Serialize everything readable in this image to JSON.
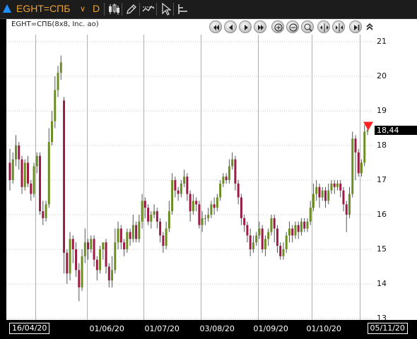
{
  "toolbar": {
    "symbol": "EGHT=СПБ",
    "interval": "D",
    "icons": [
      "up-arrow-icon",
      "chevron-down-icon",
      "candlestick-icon",
      "pencil-icon",
      "crosshair-icon",
      "cursor-icon",
      "indicator-icon"
    ]
  },
  "legend": {
    "title": "EGHT=СПБ(8x8, Inc. ao)"
  },
  "nav_icons": [
    "first-icon",
    "prev-icon",
    "play-icon",
    "last-icon",
    "zoom-in-icon",
    "zoom-out-icon",
    "zoom-fit-icon",
    "expand-icon",
    "compress-icon",
    "end-icon",
    "collapse-up-icon"
  ],
  "last_price_label": "18,44",
  "colors": {
    "up": "#6b8e23",
    "down": "#9b1b45",
    "marker": "#ff2020",
    "background": "#ffffff",
    "grid": "#c8c8c8"
  },
  "chart_data": {
    "type": "candlestick",
    "title": "EGHT=СПБ(8x8, Inc. ao)",
    "ylim": [
      13,
      21.5
    ],
    "y_ticks": [
      "13",
      "14",
      "15",
      "16",
      "17",
      "18",
      "19",
      "20",
      "21"
    ],
    "x_labels": [
      "16/04/20",
      "01/06/20",
      "01/07/20",
      "03/08/20",
      "01/09/20",
      "01/10/20",
      "05/11/20"
    ],
    "grid": "horizontal dotted, vertical solid at month boundaries",
    "last_value": 18.44,
    "candles": [
      [
        17.5,
        17.0,
        17.9,
        16.7
      ],
      [
        17.0,
        17.6,
        17.8,
        16.9
      ],
      [
        17.6,
        18.0,
        18.3,
        17.4
      ],
      [
        18.0,
        17.6,
        18.1,
        17.3
      ],
      [
        17.6,
        16.8,
        17.7,
        16.6
      ],
      [
        16.8,
        17.5,
        17.6,
        16.7
      ],
      [
        17.5,
        16.9,
        17.7,
        16.8
      ],
      [
        16.9,
        16.6,
        17.0,
        16.4
      ],
      [
        16.6,
        17.4,
        17.5,
        16.5
      ],
      [
        17.4,
        17.7,
        17.8,
        17.2
      ],
      [
        17.7,
        16.1,
        17.8,
        16.0
      ],
      [
        16.1,
        15.9,
        16.4,
        15.7
      ],
      [
        15.9,
        16.3,
        16.4,
        15.8
      ],
      [
        16.3,
        18.1,
        18.5,
        16.2
      ],
      [
        18.1,
        18.7,
        19.0,
        18.0
      ],
      [
        18.7,
        19.6,
        20.0,
        18.5
      ],
      [
        19.6,
        20.1,
        20.3,
        19.4
      ],
      [
        20.1,
        20.4,
        20.6,
        19.9
      ],
      [
        19.3,
        14.9,
        19.4,
        14.3
      ],
      [
        14.9,
        14.3,
        15.0,
        14.0
      ],
      [
        14.3,
        15.3,
        15.5,
        14.1
      ],
      [
        15.3,
        15.0,
        15.4,
        14.6
      ],
      [
        15.0,
        14.4,
        15.2,
        14.2
      ],
      [
        14.4,
        13.9,
        14.6,
        13.5
      ],
      [
        13.9,
        14.8,
        15.0,
        13.8
      ],
      [
        14.8,
        15.2,
        15.6,
        14.6
      ],
      [
        15.2,
        15.0,
        15.3,
        14.7
      ],
      [
        15.0,
        15.3,
        15.4,
        14.9
      ],
      [
        15.3,
        14.7,
        15.4,
        14.5
      ],
      [
        14.7,
        14.4,
        14.8,
        14.1
      ],
      [
        14.4,
        15.0,
        15.1,
        14.3
      ],
      [
        15.0,
        15.2,
        15.2,
        14.7
      ],
      [
        15.2,
        14.5,
        15.3,
        14.3
      ],
      [
        14.5,
        14.1,
        14.6,
        13.9
      ],
      [
        14.1,
        14.4,
        14.8,
        13.9
      ],
      [
        14.4,
        15.2,
        15.6,
        14.3
      ],
      [
        15.2,
        15.6,
        15.8,
        15.0
      ],
      [
        15.6,
        15.2,
        15.7,
        15.0
      ],
      [
        15.2,
        15.0,
        15.3,
        14.8
      ],
      [
        15.0,
        15.5,
        15.6,
        14.9
      ],
      [
        15.5,
        15.3,
        15.6,
        15.1
      ],
      [
        15.3,
        15.7,
        16.0,
        15.2
      ],
      [
        15.7,
        15.3,
        15.8,
        15.2
      ],
      [
        15.3,
        15.8,
        16.0,
        15.2
      ],
      [
        15.8,
        16.4,
        16.6,
        15.6
      ],
      [
        16.4,
        16.2,
        16.5,
        15.9
      ],
      [
        16.2,
        15.8,
        16.3,
        15.7
      ],
      [
        15.8,
        16.0,
        16.1,
        15.6
      ],
      [
        16.0,
        16.1,
        16.3,
        15.9
      ],
      [
        16.1,
        15.8,
        16.2,
        15.6
      ],
      [
        15.8,
        15.4,
        15.9,
        15.2
      ],
      [
        15.4,
        15.1,
        15.5,
        14.9
      ],
      [
        15.1,
        15.6,
        15.8,
        15.0
      ],
      [
        15.6,
        16.1,
        16.4,
        15.5
      ],
      [
        16.1,
        17.0,
        17.2,
        16.0
      ],
      [
        17.0,
        16.7,
        17.1,
        16.5
      ],
      [
        16.7,
        16.6,
        16.8,
        16.4
      ],
      [
        16.6,
        16.9,
        17.0,
        16.5
      ],
      [
        16.9,
        17.1,
        17.3,
        16.8
      ],
      [
        17.1,
        16.6,
        17.2,
        16.4
      ],
      [
        16.6,
        16.1,
        16.7,
        15.8
      ],
      [
        16.1,
        16.4,
        16.6,
        16.0
      ],
      [
        16.4,
        16.3,
        16.5,
        16.1
      ],
      [
        16.3,
        15.7,
        16.4,
        15.6
      ],
      [
        15.7,
        15.9,
        16.1,
        15.5
      ],
      [
        15.9,
        15.9,
        16.0,
        15.7
      ],
      [
        15.9,
        16.0,
        16.2,
        15.8
      ],
      [
        16.0,
        16.3,
        16.4,
        15.9
      ],
      [
        16.3,
        16.2,
        16.5,
        16.0
      ],
      [
        16.2,
        16.5,
        16.6,
        16.1
      ],
      [
        16.5,
        16.9,
        17.0,
        16.4
      ],
      [
        16.9,
        17.1,
        17.2,
        16.8
      ],
      [
        17.1,
        17.0,
        17.2,
        16.9
      ],
      [
        17.0,
        17.4,
        17.6,
        16.9
      ],
      [
        17.4,
        17.6,
        17.8,
        17.3
      ],
      [
        17.6,
        16.9,
        17.7,
        16.7
      ],
      [
        16.9,
        16.5,
        17.0,
        16.3
      ],
      [
        16.5,
        15.9,
        16.6,
        15.7
      ],
      [
        15.9,
        15.7,
        16.0,
        15.5
      ],
      [
        15.7,
        15.4,
        15.8,
        15.2
      ],
      [
        15.4,
        15.0,
        15.6,
        14.8
      ],
      [
        15.0,
        15.2,
        15.4,
        14.9
      ],
      [
        15.2,
        15.4,
        15.5,
        15.1
      ],
      [
        15.4,
        15.6,
        15.8,
        15.3
      ],
      [
        15.6,
        15.0,
        15.7,
        14.9
      ],
      [
        15.0,
        15.3,
        15.4,
        14.8
      ],
      [
        15.3,
        15.5,
        15.6,
        15.1
      ],
      [
        15.5,
        15.9,
        16.0,
        15.4
      ],
      [
        15.9,
        15.6,
        16.0,
        15.2
      ],
      [
        15.6,
        15.1,
        15.7,
        14.9
      ],
      [
        15.1,
        14.8,
        15.2,
        14.7
      ],
      [
        14.8,
        15.0,
        15.2,
        14.7
      ],
      [
        15.0,
        15.4,
        15.5,
        14.9
      ],
      [
        15.4,
        15.6,
        15.8,
        15.2
      ],
      [
        15.6,
        15.4,
        15.7,
        15.2
      ],
      [
        15.4,
        15.7,
        15.8,
        15.3
      ],
      [
        15.7,
        15.5,
        15.8,
        15.3
      ],
      [
        15.5,
        15.8,
        15.9,
        15.4
      ],
      [
        15.8,
        15.6,
        15.9,
        15.5
      ],
      [
        15.6,
        15.8,
        15.9,
        15.5
      ],
      [
        15.8,
        16.2,
        16.4,
        15.7
      ],
      [
        16.2,
        16.6,
        16.9,
        16.1
      ],
      [
        16.6,
        16.8,
        17.0,
        16.4
      ],
      [
        16.8,
        16.5,
        16.9,
        16.2
      ],
      [
        16.5,
        16.7,
        16.8,
        16.4
      ],
      [
        16.7,
        16.4,
        16.8,
        16.2
      ],
      [
        16.4,
        16.7,
        16.9,
        16.3
      ],
      [
        16.7,
        16.9,
        17.0,
        16.6
      ],
      [
        16.9,
        16.8,
        17.0,
        16.6
      ],
      [
        16.8,
        16.9,
        17.0,
        16.7
      ],
      [
        16.9,
        16.7,
        17.0,
        16.5
      ],
      [
        16.7,
        16.3,
        16.8,
        16.1
      ],
      [
        16.3,
        16.0,
        16.4,
        15.5
      ],
      [
        16.0,
        16.6,
        16.8,
        15.9
      ],
      [
        16.6,
        18.2,
        18.4,
        16.5
      ],
      [
        18.2,
        17.8,
        18.3,
        17.0
      ],
      [
        17.8,
        17.2,
        17.9,
        17.1
      ],
      [
        17.2,
        17.5,
        17.6,
        17.1
      ],
      [
        17.5,
        18.4,
        18.6,
        17.4
      ],
      [
        18.4,
        18.44,
        18.6,
        18.3
      ]
    ]
  }
}
